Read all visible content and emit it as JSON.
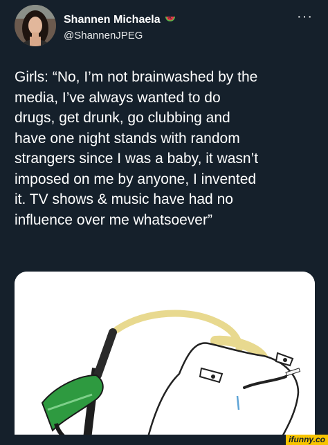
{
  "header": {
    "display_name": "Shannen Michaela",
    "handle": "@ShannenJPEG",
    "more_label": "···",
    "avatar_icon": "profile-photo",
    "badge_icon": "watermelon-icon"
  },
  "tweet": {
    "lines": [
      "Girls: “No, I’m not brainwashed by the",
      "media, I’ve always wanted to do",
      "drugs, get drunk, go clubbing and",
      "have one night stands with random",
      "strangers since I was a baby, it wasn’t",
      "imposed on me by anyone, I invented",
      "it. TV shows & music have had no",
      "influence over me whatsoever”"
    ]
  },
  "media": {
    "description_icon": "fuel-nozzle-into-head-meme"
  },
  "watermark": {
    "text": "ifunny.co"
  },
  "colors": {
    "background": "#15202b",
    "text": "#ffffff",
    "nozzle_green": "#2e9a40",
    "fuel_yellow": "#e8d98f",
    "watermark_yellow": "#f7c400"
  }
}
